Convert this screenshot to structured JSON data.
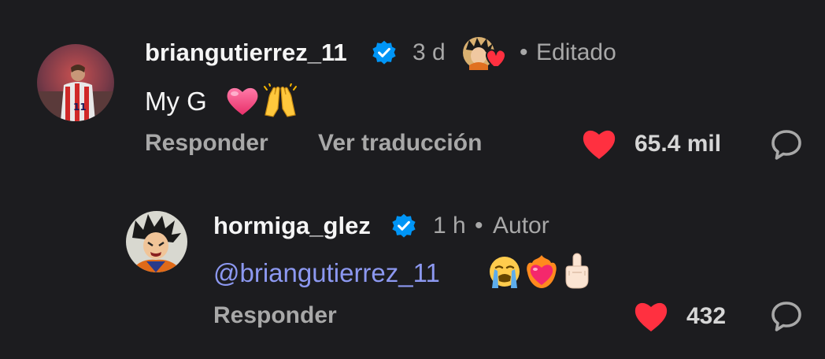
{
  "comment": {
    "username": "briangutierrez_11",
    "time": "3 d",
    "separator": "•",
    "edited": "Editado",
    "text": "My G",
    "reply_label": "Responder",
    "translate_label": "Ver traducción",
    "likes": "65.4 mil",
    "liked": true,
    "colors": {
      "heart": "#ff3040",
      "verified": "#0095f6"
    }
  },
  "reply": {
    "username": "hormiga_glez",
    "time": "1 h",
    "separator": "•",
    "author_label": "Autor",
    "mention": "@briangutierrez_11",
    "reply_label": "Responder",
    "likes": "432",
    "liked": true
  }
}
